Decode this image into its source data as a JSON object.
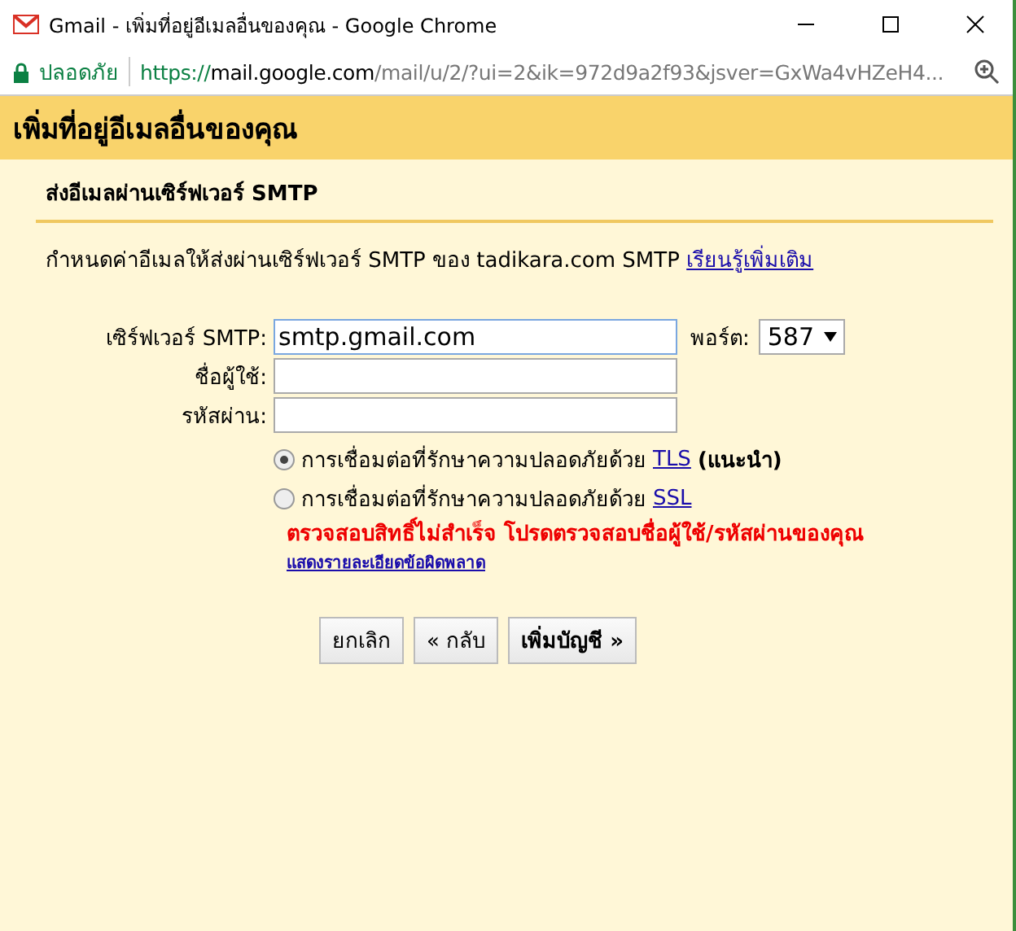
{
  "window": {
    "title": "Gmail - เพิ่มที่อยู่อีเมลอื่นของคุณ - Google Chrome"
  },
  "address_bar": {
    "security_label": "ปลอดภัย",
    "url_scheme": "https://",
    "url_host": "mail.google.com",
    "url_path": "/mail/u/2/?ui=2&ik=972d9a2f93&jsver=GxWa4vHZeH4..."
  },
  "dialog": {
    "title": "เพิ่มที่อยู่อีเมลอื่นของคุณ",
    "section_title": "ส่งอีเมลผ่านเซิร์ฟเวอร์ SMTP",
    "description": "กำหนดค่าอีเมลให้ส่งผ่านเซิร์ฟเวอร์ SMTP ของ tadikara.com SMTP",
    "learn_more_link": "เรียนรู้เพิ่มเติม",
    "fields": [
      {
        "label": "เซิร์ฟเวอร์ SMTP:",
        "value": "smtp.gmail.com"
      },
      {
        "label": "ชื่อผู้ใช้:"
      },
      {
        "label": "รหัสผ่าน:"
      }
    ],
    "port": {
      "label": "พอร์ต:",
      "value": "587"
    },
    "security_options": [
      {
        "label": "การเชื่อมต่อที่รักษาความปลอดภัยด้วย",
        "link": "TLS",
        "note": "(แนะนำ)",
        "selected": true
      },
      {
        "label": "การเชื่อมต่อที่รักษาความปลอดภัยด้วย",
        "link": "SSL",
        "selected": false
      }
    ],
    "error": "ตรวจสอบสิทธิ์ไม่สำเร็จ โปรดตรวจสอบชื่อผู้ใช้/รหัสผ่านของคุณ",
    "error_details_link": "แสดงรายละเอียดข้อผิดพลาด",
    "buttons": [
      "ยกเลิก",
      "« กลับ",
      "เพิ่มบัญชี »"
    ]
  }
}
